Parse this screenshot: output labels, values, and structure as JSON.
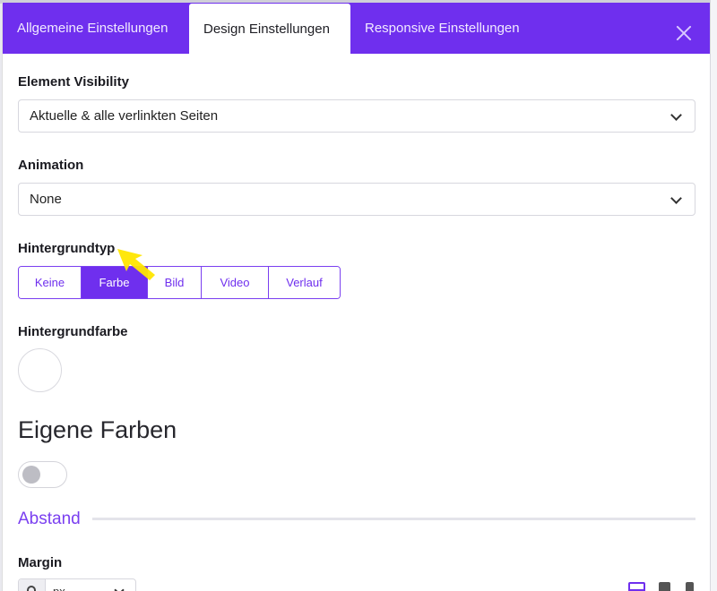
{
  "tabs": [
    {
      "label": "Allgemeine Einstellungen",
      "active": false
    },
    {
      "label": "Design Einstellungen",
      "active": true
    },
    {
      "label": "Responsive Einstellungen",
      "active": false
    }
  ],
  "visibility": {
    "label": "Element Visibility",
    "value": "Aktuelle & alle verlinkten Seiten"
  },
  "animation": {
    "label": "Animation",
    "value": "None"
  },
  "background_type": {
    "label": "Hintergrundtyp",
    "options": [
      "Keine",
      "Farbe",
      "Bild",
      "Video",
      "Verlauf"
    ],
    "selected": "Farbe"
  },
  "background_color": {
    "label": "Hintergrundfarbe",
    "value_color": "#ffffff"
  },
  "custom_colors": {
    "heading": "Eigene Farben",
    "enabled": false
  },
  "spacing": {
    "section_title": "Abstand",
    "margin_label": "Margin",
    "unit": "px"
  },
  "colors": {
    "accent": "#6f2fee",
    "cursor_highlight": "#ffe600"
  },
  "icons": {
    "close": "close-icon",
    "chevron": "chevron-down-icon",
    "lock": "lock-icon",
    "desktop": "desktop-icon",
    "tablet": "tablet-icon",
    "mobile": "mobile-icon",
    "cursor": "mouse-cursor-icon"
  }
}
